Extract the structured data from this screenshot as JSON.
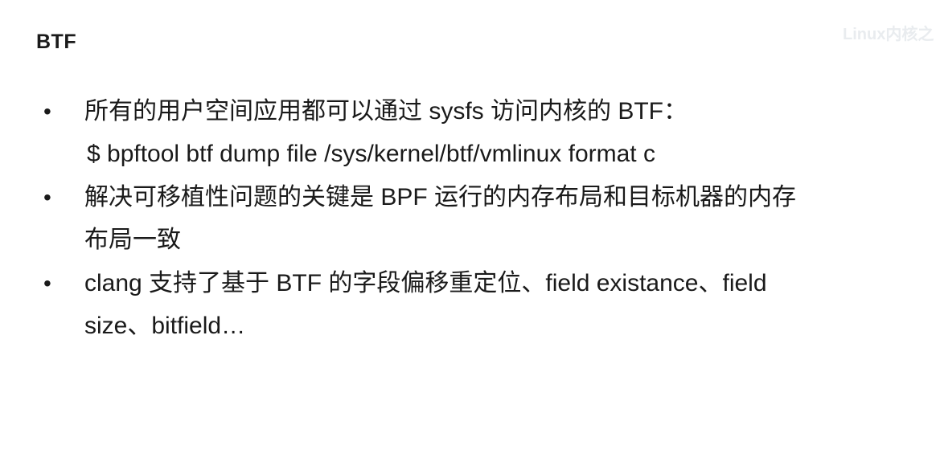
{
  "slide": {
    "title": "BTF",
    "watermark": "Linux内核之",
    "bullets": [
      {
        "line1": "所有的用户空间应用都可以通过  sysfs  访问内核的 BTF：",
        "line2": "$ bpftool btf dump file /sys/kernel/btf/vmlinux format c"
      },
      {
        "line1": "解决可移植性问题的关键是 BPF 运行的内存布局和目标机器的内存",
        "line2": "布局一致"
      },
      {
        "line1": "clang 支持了基于 BTF 的字段偏移重定位、field existance、field",
        "line2": "size、bitfield…"
      }
    ],
    "bullet_symbol": "•"
  }
}
